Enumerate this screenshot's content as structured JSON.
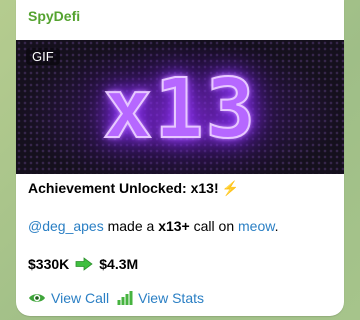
{
  "channel": {
    "name": "SpyDefi",
    "name_color": "#55a330"
  },
  "media": {
    "badge": "GIF",
    "text": "x13",
    "glow_color": "#a24dff"
  },
  "message": {
    "title": "Achievement Unlocked: x13!",
    "title_icon": "lightning-bolt-icon",
    "user": "@deg_apes",
    "text_made": "made a",
    "multiplier": "x13+",
    "text_call_on": "call on",
    "token": "meow",
    "text_period": ".",
    "from_value": "$330K",
    "arrow_icon": "right-arrow-icon",
    "to_value": "$4.3M"
  },
  "actions": {
    "view_call": "View Call",
    "view_call_icon": "eye-icon",
    "view_stats": "View Stats",
    "view_stats_icon": "bar-chart-icon"
  },
  "colors": {
    "link": "#2a7fc4",
    "chat_background": "#a9c38f",
    "arrow": "#3fbf3f",
    "bolt": "#f3b61f"
  }
}
